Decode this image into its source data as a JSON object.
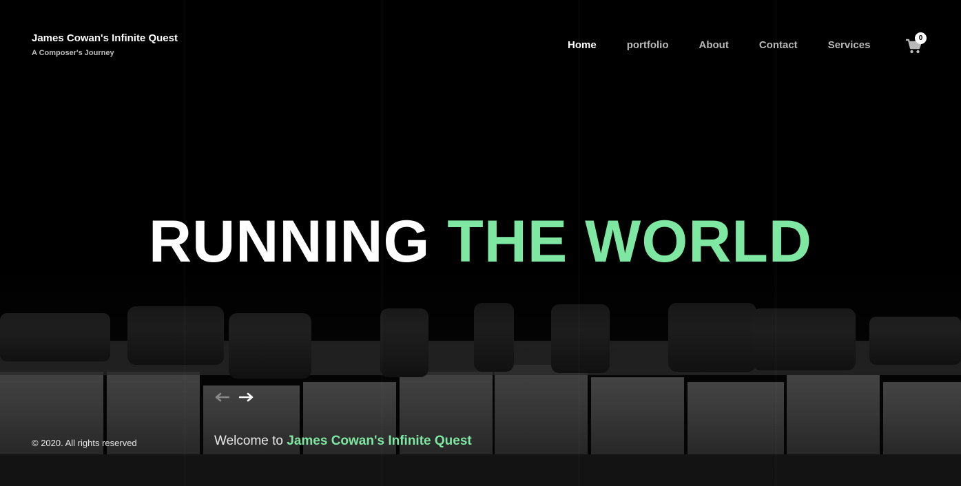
{
  "brand": {
    "title": "James Cowan's Infinite Quest",
    "subtitle": "A Composer's Journey"
  },
  "nav": {
    "items": [
      {
        "label": "Home",
        "active": true
      },
      {
        "label": "portfolio",
        "active": false
      },
      {
        "label": "About",
        "active": false
      },
      {
        "label": "Contact",
        "active": false
      },
      {
        "label": "Services",
        "active": false
      }
    ]
  },
  "cart": {
    "icon": "cart-icon",
    "count": "0"
  },
  "hero": {
    "headline_part1": "RUNNING",
    "headline_part2": "THE WORLD"
  },
  "slider": {
    "prev_icon": "arrow-left-icon",
    "next_icon": "arrow-right-icon"
  },
  "footer": {
    "copyright": "© 2020. All rights reserved",
    "welcome_prefix": "Welcome to",
    "welcome_name": "James Cowan's Infinite Quest"
  },
  "colors": {
    "accent": "#7ee8a2",
    "background": "#050505",
    "text": "#ffffff"
  }
}
